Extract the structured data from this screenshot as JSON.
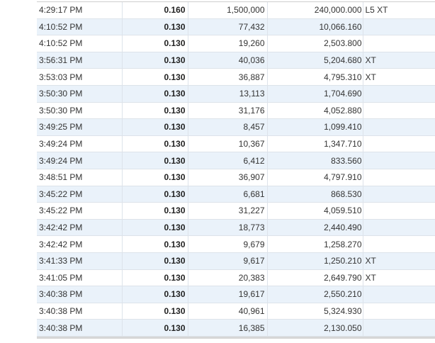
{
  "trades": {
    "rows": [
      {
        "time": "4:29:17 PM",
        "price": "0.160",
        "size": "1,500,000",
        "value": "240,000.000",
        "cond": "L5 XT"
      },
      {
        "time": "4:10:52 PM",
        "price": "0.130",
        "size": "77,432",
        "value": "10,066.160",
        "cond": ""
      },
      {
        "time": "4:10:52 PM",
        "price": "0.130",
        "size": "19,260",
        "value": "2,503.800",
        "cond": ""
      },
      {
        "time": "3:56:31 PM",
        "price": "0.130",
        "size": "40,036",
        "value": "5,204.680",
        "cond": "XT"
      },
      {
        "time": "3:53:03 PM",
        "price": "0.130",
        "size": "36,887",
        "value": "4,795.310",
        "cond": "XT"
      },
      {
        "time": "3:50:30 PM",
        "price": "0.130",
        "size": "13,113",
        "value": "1,704.690",
        "cond": ""
      },
      {
        "time": "3:50:30 PM",
        "price": "0.130",
        "size": "31,176",
        "value": "4,052.880",
        "cond": ""
      },
      {
        "time": "3:49:25 PM",
        "price": "0.130",
        "size": "8,457",
        "value": "1,099.410",
        "cond": ""
      },
      {
        "time": "3:49:24 PM",
        "price": "0.130",
        "size": "10,367",
        "value": "1,347.710",
        "cond": ""
      },
      {
        "time": "3:49:24 PM",
        "price": "0.130",
        "size": "6,412",
        "value": "833.560",
        "cond": ""
      },
      {
        "time": "3:48:51 PM",
        "price": "0.130",
        "size": "36,907",
        "value": "4,797.910",
        "cond": ""
      },
      {
        "time": "3:45:22 PM",
        "price": "0.130",
        "size": "6,681",
        "value": "868.530",
        "cond": ""
      },
      {
        "time": "3:45:22 PM",
        "price": "0.130",
        "size": "31,227",
        "value": "4,059.510",
        "cond": ""
      },
      {
        "time": "3:42:42 PM",
        "price": "0.130",
        "size": "18,773",
        "value": "2,440.490",
        "cond": ""
      },
      {
        "time": "3:42:42 PM",
        "price": "0.130",
        "size": "9,679",
        "value": "1,258.270",
        "cond": ""
      },
      {
        "time": "3:41:33 PM",
        "price": "0.130",
        "size": "9,617",
        "value": "1,250.210",
        "cond": "XT"
      },
      {
        "time": "3:41:05 PM",
        "price": "0.130",
        "size": "20,383",
        "value": "2,649.790",
        "cond": "XT"
      },
      {
        "time": "3:40:38 PM",
        "price": "0.130",
        "size": "19,617",
        "value": "2,550.210",
        "cond": ""
      },
      {
        "time": "3:40:38 PM",
        "price": "0.130",
        "size": "40,961",
        "value": "5,324.930",
        "cond": ""
      },
      {
        "time": "3:40:38 PM",
        "price": "0.130",
        "size": "16,385",
        "value": "2,130.050",
        "cond": ""
      }
    ]
  }
}
